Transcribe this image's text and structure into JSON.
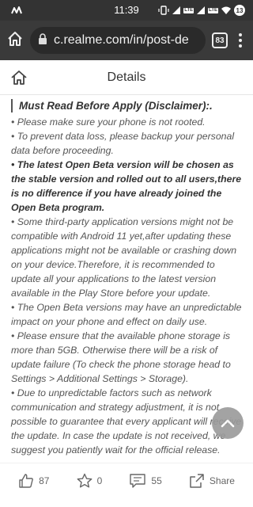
{
  "status_bar": {
    "time": "11:39",
    "lte1": "LTE",
    "lte2": "LTE",
    "battery": "13"
  },
  "browser": {
    "url": "c.realme.com/in/post-de",
    "tab_count": "83"
  },
  "header": {
    "title": "Details"
  },
  "content": {
    "heading": "Must Read Before Apply (Disclaimer):.",
    "paragraphs": [
      {
        "text": "• Please make sure your phone is not rooted.",
        "bold": false
      },
      {
        "text": "• To prevent data loss, please backup your personal data before proceeding.",
        "bold": false
      },
      {
        "text": "• The latest Open Beta version will be chosen as the stable version and rolled out to all users,there is no difference if you have already joined the Open Beta program.",
        "bold": true
      },
      {
        "text": "• Some third-party application versions might not be compatible with Android 11 yet,after updating these applications might not be available or crashing down on your device.Therefore, it is recommended to update all your applications to the latest version available in the Play Store before your update.",
        "bold": false
      },
      {
        "text": "• The Open Beta versions may have an unpredictable impact on your phone and effect on daily use.",
        "bold": false
      },
      {
        "text": "• Please ensure that the available phone storage is more than 5GB. Otherwise there will be a risk of update failure (To check the phone storage head to Settings > Additional Settings > Storage).",
        "bold": false
      },
      {
        "text": "• Due to unpredictable factors such as network communication and strategy adjustment, it is not possible to guarantee that every applicant will receive the update. In case the update is not received, we suggest you patiently wait for the official release.",
        "bold": false
      }
    ]
  },
  "actions": {
    "like_count": "87",
    "star_count": "0",
    "comment_count": "55",
    "share_label": "Share"
  },
  "colors": {
    "status_bar_bg": "#333333",
    "browser_bar_bg": "#3a3a3a",
    "url_pill_bg": "#2a2a2a",
    "scroll_top_bg": "#9a9a9a"
  },
  "icons": {
    "status_left": "activity-icon",
    "home": "home-icon",
    "lock": "lock-icon",
    "scroll_top": "chevron-up-icon",
    "like": "thumbs-up-icon",
    "star": "star-icon",
    "comment": "comment-icon",
    "share": "share-icon"
  }
}
